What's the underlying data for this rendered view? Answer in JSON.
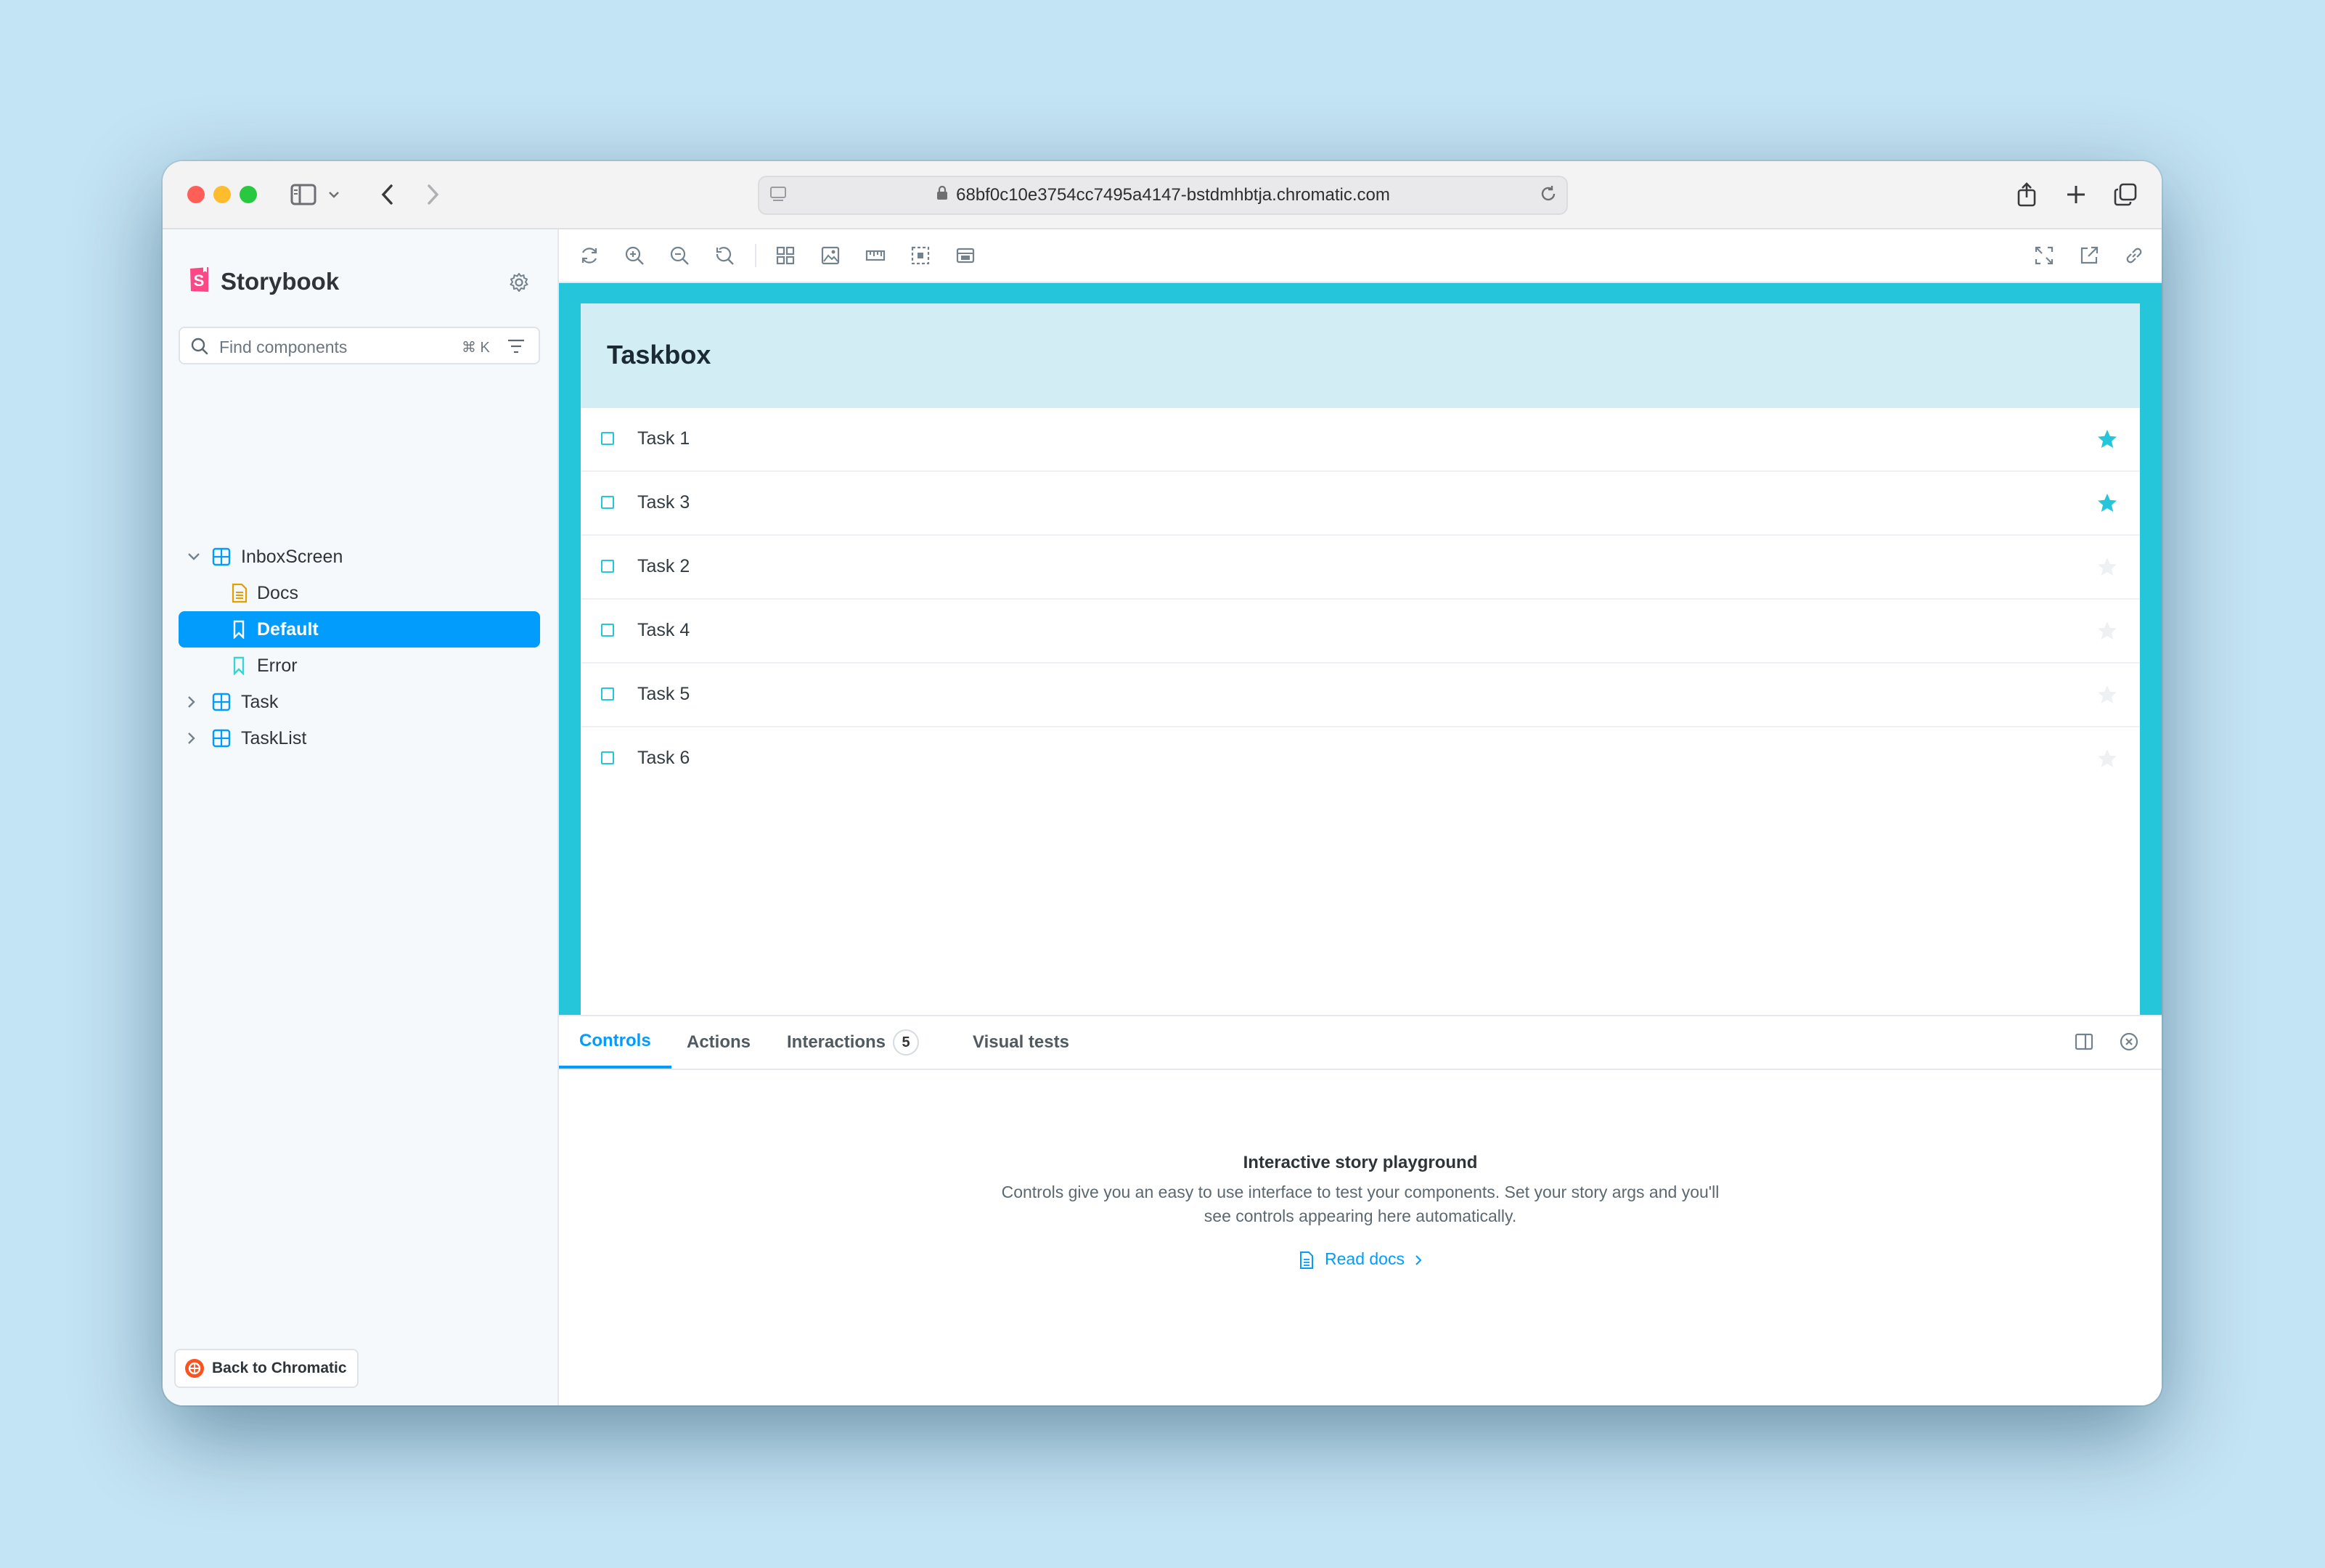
{
  "browser": {
    "url": "68bf0c10e3754cc7495a4147-bstdmhbtja.chromatic.com",
    "traffic_light_colors": {
      "close": "#ff5f57",
      "minimize": "#febc2e",
      "maximize": "#28c840"
    }
  },
  "sidebar": {
    "brand": "Storybook",
    "search_placeholder": "Find components",
    "search_shortcut": "⌘ K",
    "tree": [
      {
        "label": "InboxScreen",
        "type": "component",
        "expanded": true
      },
      {
        "label": "Docs",
        "type": "docs"
      },
      {
        "label": "Default",
        "type": "story",
        "selected": true
      },
      {
        "label": "Error",
        "type": "story"
      },
      {
        "label": "Task",
        "type": "component",
        "expanded": false
      },
      {
        "label": "TaskList",
        "type": "component",
        "expanded": false
      }
    ],
    "back_button": "Back to Chromatic"
  },
  "preview": {
    "title": "Taskbox",
    "tasks": [
      {
        "title": "Task 1",
        "pinned": true
      },
      {
        "title": "Task 3",
        "pinned": true
      },
      {
        "title": "Task 2",
        "pinned": false
      },
      {
        "title": "Task 4",
        "pinned": false
      },
      {
        "title": "Task 5",
        "pinned": false
      },
      {
        "title": "Task 6",
        "pinned": false
      }
    ]
  },
  "panel": {
    "tabs": [
      {
        "label": "Controls",
        "active": true
      },
      {
        "label": "Actions"
      },
      {
        "label": "Interactions",
        "badge": "5"
      },
      {
        "label": "Visual tests"
      }
    ],
    "empty_title": "Interactive story playground",
    "empty_desc": "Controls give you an easy to use interface to test your components. Set your story args and you'll see controls appearing here automatically.",
    "read_docs": "Read docs"
  },
  "colors": {
    "accent": "#029cfd",
    "canvas": "#26c6da",
    "header": "#d3edf4",
    "star_pinned": "#26c6da",
    "star_unpinned": "#eef1f3"
  }
}
